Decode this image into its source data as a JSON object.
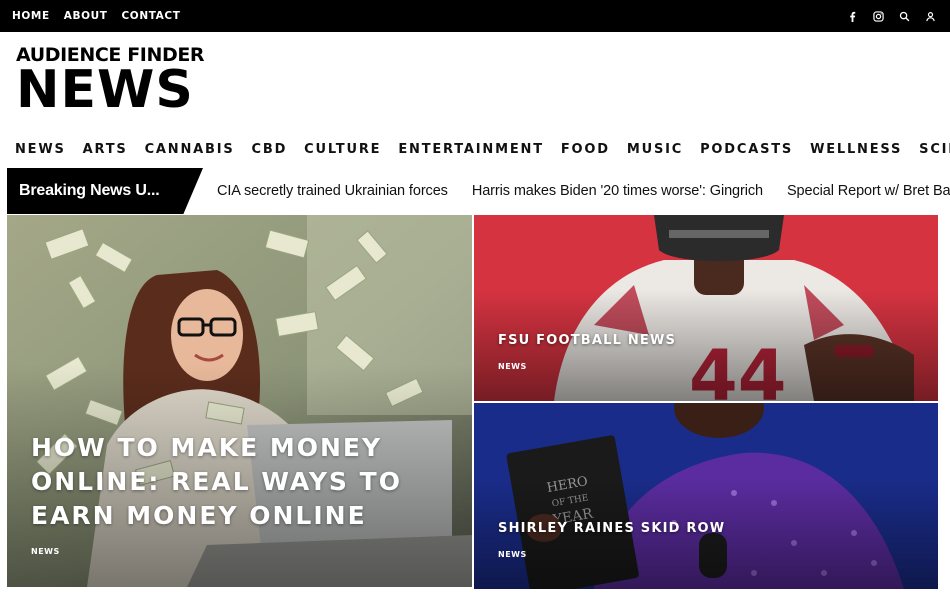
{
  "top_nav": {
    "items": [
      "HOME",
      "ABOUT",
      "CONTACT"
    ]
  },
  "top_icons": [
    "facebook-icon",
    "instagram-icon",
    "search-icon",
    "user-icon"
  ],
  "logo": {
    "line1": "AUDIENCE FINDER",
    "line2": "NEWS"
  },
  "main_nav": {
    "items": [
      "NEWS",
      "ARTS",
      "CANNABIS",
      "CBD",
      "CULTURE",
      "ENTERTAINMENT",
      "FOOD",
      "MUSIC",
      "PODCASTS",
      "WELLNESS",
      "SCIENCE"
    ]
  },
  "breaking": {
    "label": "Breaking News U...",
    "items": [
      "CIA secretly trained Ukrainian forces",
      "Harris makes Biden '20 times worse': Gingrich",
      "Special Report w/ Bret Baier"
    ]
  },
  "featured": {
    "main": {
      "title": "HOW TO MAKE MONEY ONLINE: REAL WAYS TO EARN MONEY ONLINE",
      "category": "NEWS"
    },
    "top": {
      "title": "FSU FOOTBALL NEWS",
      "category": "NEWS"
    },
    "bottom": {
      "title": "SHIRLEY RAINES SKID ROW",
      "category": "NEWS"
    }
  },
  "colors": {
    "black": "#000000",
    "red_card": "#d63341",
    "purple_card": "#1a2c8a"
  }
}
